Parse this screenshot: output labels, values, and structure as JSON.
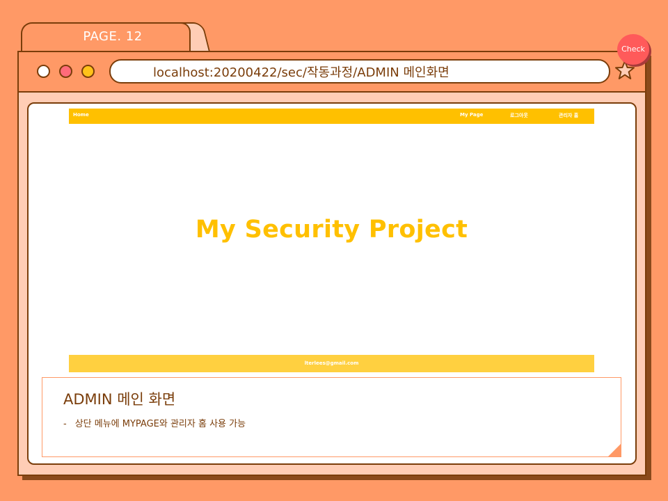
{
  "slide": {
    "page_label": "PAGE. 12",
    "check_label": "Check"
  },
  "browser": {
    "url": "localhost:20200422/sec/작동과정/ADMIN 메인화면",
    "window_controls": [
      "close-dot",
      "minimize-dot",
      "maximize-dot"
    ],
    "bookmark_icon": "star-icon"
  },
  "site": {
    "nav": {
      "home": "Home",
      "my_page": "My Page",
      "logout": "로그아웃",
      "admin_home": "관리자 홈"
    },
    "hero_title": "My Security Project",
    "footer_email": "lterlees@gmail.com"
  },
  "note": {
    "title": "ADMIN 메인 화면",
    "bullet_dash": "-",
    "bullet": "상단 메뉴에 MYPAGE와 관리자 홈 사용 가능"
  },
  "colors": {
    "background": "#ff9966",
    "accent": "#ffc000",
    "outline": "#7a3d0a",
    "check_badge": "#ff5a5a"
  }
}
